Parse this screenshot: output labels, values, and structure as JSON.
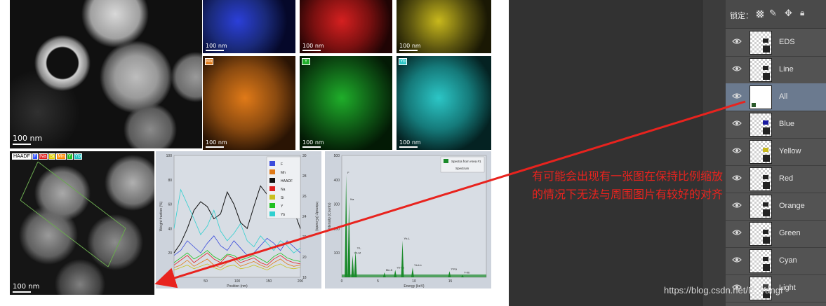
{
  "figure": {
    "haadf_scale": "100 nm",
    "map_scale": "100 nm",
    "overlay_scale": "100 nm",
    "overlay_tags": [
      "HAADF",
      "F",
      "Na",
      "Si",
      "Mn",
      "Y",
      "Yb"
    ],
    "overlay_tag_colors": [
      "#ffffff",
      "#3050ff",
      "#e02020",
      "#e0d000",
      "#ff8800",
      "#20c020",
      "#20c0c0"
    ],
    "map_colors": {
      "blue": "#2b3fd9",
      "red": "#d52020",
      "yellow": "#c8b81c",
      "orange": "#e07a18",
      "green": "#1fae2a",
      "cyan": "#2cc6c6"
    }
  },
  "chart_data": [
    {
      "type": "line",
      "title": "",
      "xlabel": "Position (nm)",
      "ylabel": "Weight fraction (%)",
      "y2label": "Intensity (kCounts)",
      "xlim": [
        0,
        200
      ],
      "ylim": [
        0,
        100
      ],
      "xticks": [
        "50",
        "100",
        "150",
        "200"
      ],
      "yticks": [
        "0",
        "20",
        "40",
        "60",
        "80",
        "100"
      ],
      "y2ticks": [
        "18",
        "20",
        "22",
        "24",
        "26",
        "28",
        "30"
      ],
      "legend": [
        "F",
        "Mn",
        "HAADF",
        "Na",
        "Si",
        "Y",
        "Yb"
      ],
      "series": [
        {
          "name": "F",
          "color": "#3a4bdc",
          "values": [
            18,
            22,
            30,
            25,
            20,
            28,
            34,
            26,
            22,
            30,
            24,
            18,
            20,
            26,
            32,
            28,
            22,
            30,
            25,
            20
          ]
        },
        {
          "name": "Mn",
          "color": "#e07a18",
          "values": [
            8,
            10,
            14,
            9,
            12,
            15,
            10,
            8,
            12,
            14,
            9,
            11,
            13,
            10,
            8,
            12,
            15,
            11,
            9,
            10
          ]
        },
        {
          "name": "HAADF",
          "color": "#111111",
          "values": [
            20,
            28,
            40,
            55,
            62,
            58,
            48,
            52,
            70,
            60,
            45,
            40,
            58,
            75,
            68,
            62,
            80,
            72,
            55,
            40
          ]
        },
        {
          "name": "Na",
          "color": "#e02020",
          "values": [
            10,
            14,
            18,
            12,
            16,
            20,
            15,
            12,
            18,
            16,
            12,
            14,
            16,
            12,
            10,
            15,
            18,
            14,
            12,
            11
          ]
        },
        {
          "name": "Si",
          "color": "#c9c020",
          "values": [
            6,
            8,
            10,
            7,
            9,
            11,
            8,
            6,
            9,
            10,
            7,
            8,
            10,
            8,
            6,
            9,
            11,
            8,
            7,
            8
          ]
        },
        {
          "name": "Y",
          "color": "#20c020",
          "values": [
            12,
            16,
            20,
            15,
            18,
            22,
            17,
            14,
            19,
            18,
            14,
            16,
            18,
            15,
            12,
            17,
            20,
            16,
            14,
            13
          ]
        },
        {
          "name": "Yb",
          "color": "#30d0d0",
          "values": [
            40,
            72,
            60,
            48,
            35,
            42,
            55,
            38,
            30,
            36,
            44,
            30,
            25,
            34,
            28,
            22,
            30,
            26,
            20,
            24
          ]
        }
      ]
    },
    {
      "type": "line",
      "title": "",
      "xlabel": "Energy (keV)",
      "ylabel": "Intensity (Counts)",
      "xlim": [
        0,
        20
      ],
      "ylim": [
        0,
        500
      ],
      "xticks": [
        "0",
        "5",
        "10",
        "15"
      ],
      "yticks": [
        "100",
        "200",
        "300",
        "400",
        "500"
      ],
      "legend": [
        "Spectra from Area #1",
        "Spectrum"
      ],
      "peaks": [
        {
          "x": 0.6,
          "y": 420,
          "label": "F"
        },
        {
          "x": 1.0,
          "y": 310,
          "label": "Na"
        },
        {
          "x": 1.5,
          "y": 90,
          "label": "Yb-M"
        },
        {
          "x": 1.9,
          "y": 110,
          "label": "Y-L"
        },
        {
          "x": 5.9,
          "y": 20,
          "label": "Mn-K"
        },
        {
          "x": 7.4,
          "y": 30,
          "label": "Yb-La"
        },
        {
          "x": 8.4,
          "y": 150,
          "label": "Yb-L"
        },
        {
          "x": 9.8,
          "y": 40,
          "label": "Yb-Lb"
        },
        {
          "x": 14.9,
          "y": 25,
          "label": "Y-Ka"
        },
        {
          "x": 16.7,
          "y": 10,
          "label": "Y-Kb"
        }
      ]
    }
  ],
  "annotation": {
    "text": "有可能会出现有一张图在保持比例缩放的情况下无法与周围图片有较好的对齐",
    "color": "#e8231e"
  },
  "layers_panel": {
    "lock_label": "锁定：",
    "selected": "All",
    "layers": [
      {
        "name": "EDS",
        "visible": true
      },
      {
        "name": "Line",
        "visible": true
      },
      {
        "name": "All",
        "visible": true
      },
      {
        "name": "Blue",
        "visible": true
      },
      {
        "name": "Yellow",
        "visible": true
      },
      {
        "name": "Red",
        "visible": true
      },
      {
        "name": "Orange",
        "visible": true
      },
      {
        "name": "Green",
        "visible": true
      },
      {
        "name": "Cyan",
        "visible": true
      },
      {
        "name": "Light",
        "visible": true
      }
    ]
  },
  "watermark": "https://blog.csdn.net/D_Yangf"
}
